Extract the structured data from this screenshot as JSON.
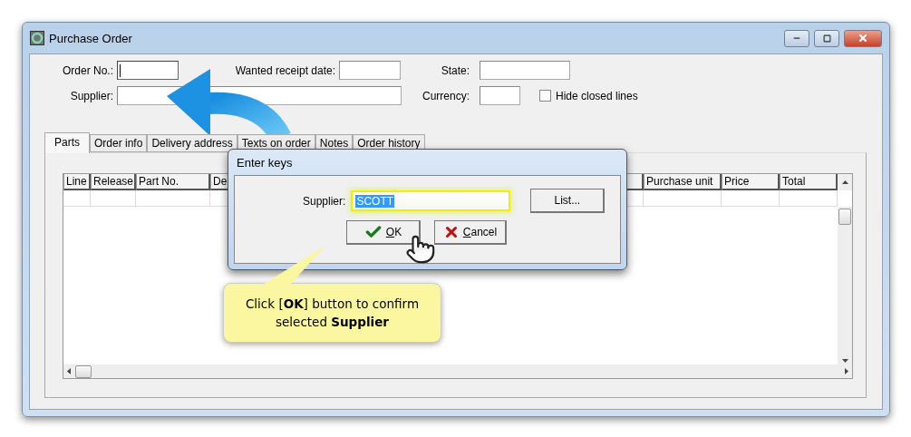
{
  "window": {
    "title": "Purchase Order"
  },
  "fields": [
    {
      "label": "Order No.:",
      "focused": true
    },
    {
      "label": "Wanted receipt date:",
      "focused": false
    },
    {
      "label": "State:",
      "focused": false
    },
    {
      "label": "Supplier:",
      "focused": false
    },
    {
      "label": "Currency:",
      "focused": false
    }
  ],
  "hide_closed_lines": {
    "label": "Hide closed lines",
    "checked": false
  },
  "tabs": [
    {
      "label": "Parts",
      "selected": true
    },
    {
      "label": "Order info",
      "selected": false
    },
    {
      "label": "Delivery address",
      "selected": false
    },
    {
      "label": "Texts on order",
      "selected": false
    },
    {
      "label": "Notes",
      "selected": false
    },
    {
      "label": "Order history",
      "selected": false
    }
  ],
  "table": {
    "columns": [
      "Line",
      "Release",
      "Part No.",
      "De",
      "Purchase unit",
      "Price",
      "Total"
    ]
  },
  "dialog": {
    "title": "Enter keys",
    "field_label": "Supplier:",
    "field_value": "SCOTT",
    "value_selected": true,
    "buttons": [
      {
        "kind": "list",
        "label": "List..."
      },
      {
        "kind": "ok",
        "label": "OK"
      },
      {
        "kind": "cancel",
        "label": "Cancel"
      }
    ]
  },
  "callout": {
    "text": "Click [**OK**] button to confirm selected **Supplier**"
  }
}
